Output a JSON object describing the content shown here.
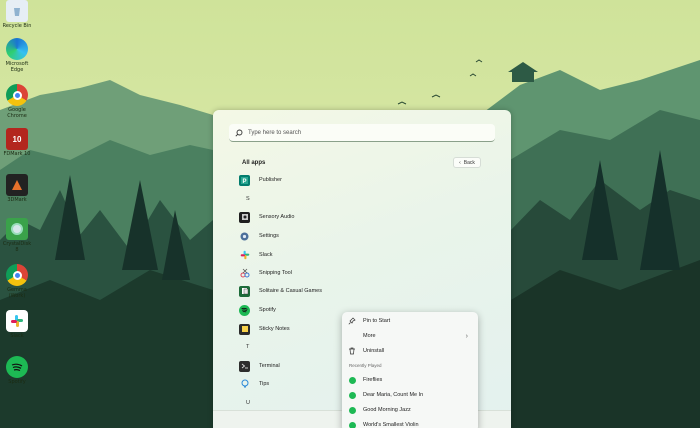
{
  "desktop": {
    "icons": [
      {
        "label": "Recycle Bin",
        "icon": "recycle-bin-icon"
      },
      {
        "label": "Microsoft\nEdge",
        "icon": "edge-icon"
      },
      {
        "label": "Google\nChrome",
        "icon": "chrome-icon"
      },
      {
        "label": "FDMark 10",
        "icon": "3dmark-icon"
      },
      {
        "label": "3DMark",
        "icon": "3dmark-icon"
      },
      {
        "label": "CrystalDisk\n8",
        "icon": "crystaldisk-icon"
      },
      {
        "label": "Gemma\n(Work)",
        "icon": "chrome-profile-icon"
      },
      {
        "label": "Slack",
        "icon": "slack-icon"
      },
      {
        "label": "Spotify",
        "icon": "spotify-icon"
      }
    ]
  },
  "start_menu": {
    "search_placeholder": "Type here to search",
    "all_apps_title": "All apps",
    "back_label": "Back",
    "apps": [
      {
        "name": "Publisher",
        "icon": "publisher-icon"
      },
      {
        "letter": "S"
      },
      {
        "name": "Sensory Audio",
        "icon": "sensory-audio-icon"
      },
      {
        "name": "Settings",
        "icon": "gear-icon"
      },
      {
        "name": "Slack",
        "icon": "slack-icon"
      },
      {
        "name": "Snipping Tool",
        "icon": "snipping-tool-icon"
      },
      {
        "name": "Solitaire & Casual Games",
        "icon": "solitaire-icon"
      },
      {
        "name": "Spotify",
        "icon": "spotify-icon"
      },
      {
        "name": "Sticky Notes",
        "icon": "sticky-notes-icon"
      },
      {
        "letter": "T"
      },
      {
        "name": "Terminal",
        "icon": "terminal-icon"
      },
      {
        "name": "Tips",
        "icon": "tips-icon"
      },
      {
        "letter": "U"
      }
    ]
  },
  "context_menu": {
    "pin_to_start": "Pin to Start",
    "more": "More",
    "uninstall": "Uninstall",
    "recently_played_header": "Recently Played",
    "recent": [
      "Fireflies",
      "Dear Maria, Count Me In",
      "Good Morning Jazz",
      "World's Smallest Violin"
    ]
  },
  "colors": {
    "sky": "#d2e59a",
    "mountain_far": "#6aa07a",
    "forest_dark": "#1f4030",
    "spotify_green": "#1db954"
  }
}
